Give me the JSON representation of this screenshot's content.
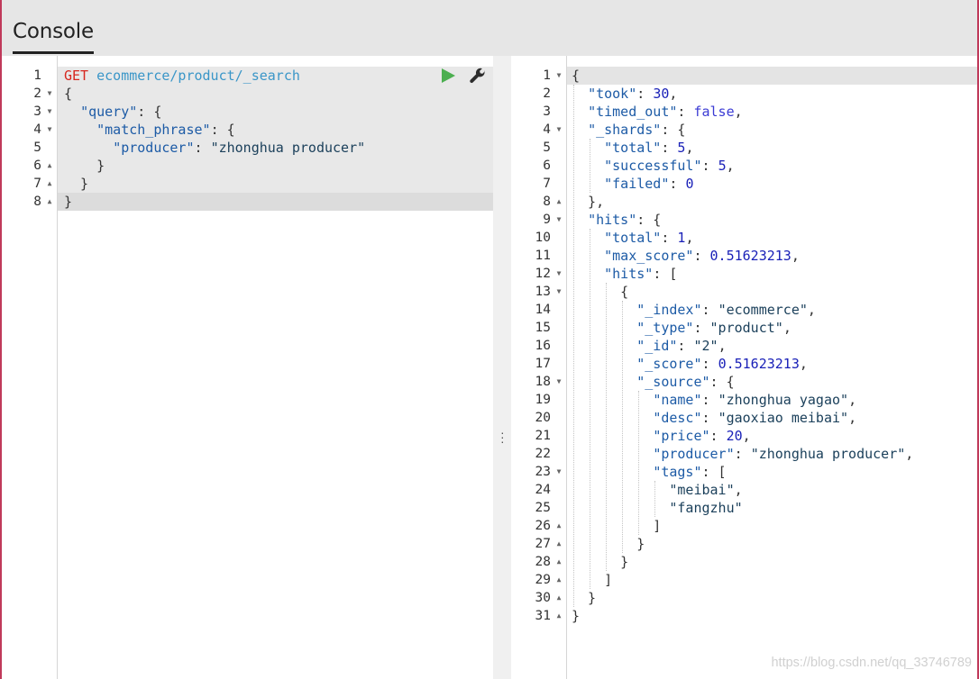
{
  "header": {
    "tab": "Console"
  },
  "request_editor": {
    "lines": [
      {
        "n": "1",
        "fold": "",
        "parts": [
          [
            "method",
            "GET"
          ],
          [
            "punc",
            " "
          ],
          [
            "url",
            "ecommerce/product/_search"
          ]
        ]
      },
      {
        "n": "2",
        "fold": "open",
        "parts": [
          [
            "punc",
            "{"
          ]
        ]
      },
      {
        "n": "3",
        "fold": "open",
        "parts": [
          [
            "punc",
            "  "
          ],
          [
            "key",
            "\"query\""
          ],
          [
            "punc",
            ": {"
          ]
        ]
      },
      {
        "n": "4",
        "fold": "open",
        "parts": [
          [
            "punc",
            "    "
          ],
          [
            "key",
            "\"match_phrase\""
          ],
          [
            "punc",
            ": {"
          ]
        ]
      },
      {
        "n": "5",
        "fold": "",
        "parts": [
          [
            "punc",
            "      "
          ],
          [
            "key",
            "\"producer\""
          ],
          [
            "punc",
            ": "
          ],
          [
            "str",
            "\"zhonghua producer\""
          ]
        ]
      },
      {
        "n": "6",
        "fold": "close",
        "parts": [
          [
            "punc",
            "    }"
          ]
        ]
      },
      {
        "n": "7",
        "fold": "close",
        "parts": [
          [
            "punc",
            "  }"
          ]
        ]
      },
      {
        "n": "8",
        "fold": "close",
        "parts": [
          [
            "punc",
            "}"
          ]
        ]
      }
    ],
    "run_icon": "play-icon",
    "settings_icon": "wrench-icon"
  },
  "response_viewer": {
    "lines": [
      {
        "n": "1",
        "fold": "open",
        "parts": [
          [
            "punc",
            "{"
          ]
        ]
      },
      {
        "n": "2",
        "fold": "",
        "parts": [
          [
            "punc",
            "  "
          ],
          [
            "key",
            "\"took\""
          ],
          [
            "punc",
            ": "
          ],
          [
            "num",
            "30"
          ],
          [
            "punc",
            ","
          ]
        ]
      },
      {
        "n": "3",
        "fold": "",
        "parts": [
          [
            "punc",
            "  "
          ],
          [
            "key",
            "\"timed_out\""
          ],
          [
            "punc",
            ": "
          ],
          [
            "bool",
            "false"
          ],
          [
            "punc",
            ","
          ]
        ]
      },
      {
        "n": "4",
        "fold": "open",
        "parts": [
          [
            "punc",
            "  "
          ],
          [
            "key",
            "\"_shards\""
          ],
          [
            "punc",
            ": {"
          ]
        ]
      },
      {
        "n": "5",
        "fold": "",
        "parts": [
          [
            "punc",
            "    "
          ],
          [
            "key",
            "\"total\""
          ],
          [
            "punc",
            ": "
          ],
          [
            "num",
            "5"
          ],
          [
            "punc",
            ","
          ]
        ]
      },
      {
        "n": "6",
        "fold": "",
        "parts": [
          [
            "punc",
            "    "
          ],
          [
            "key",
            "\"successful\""
          ],
          [
            "punc",
            ": "
          ],
          [
            "num",
            "5"
          ],
          [
            "punc",
            ","
          ]
        ]
      },
      {
        "n": "7",
        "fold": "",
        "parts": [
          [
            "punc",
            "    "
          ],
          [
            "key",
            "\"failed\""
          ],
          [
            "punc",
            ": "
          ],
          [
            "num",
            "0"
          ]
        ]
      },
      {
        "n": "8",
        "fold": "close",
        "parts": [
          [
            "punc",
            "  },"
          ]
        ]
      },
      {
        "n": "9",
        "fold": "open",
        "parts": [
          [
            "punc",
            "  "
          ],
          [
            "key",
            "\"hits\""
          ],
          [
            "punc",
            ": {"
          ]
        ]
      },
      {
        "n": "10",
        "fold": "",
        "parts": [
          [
            "punc",
            "    "
          ],
          [
            "key",
            "\"total\""
          ],
          [
            "punc",
            ": "
          ],
          [
            "num",
            "1"
          ],
          [
            "punc",
            ","
          ]
        ]
      },
      {
        "n": "11",
        "fold": "",
        "parts": [
          [
            "punc",
            "    "
          ],
          [
            "key",
            "\"max_score\""
          ],
          [
            "punc",
            ": "
          ],
          [
            "num",
            "0.51623213"
          ],
          [
            "punc",
            ","
          ]
        ]
      },
      {
        "n": "12",
        "fold": "open",
        "parts": [
          [
            "punc",
            "    "
          ],
          [
            "key",
            "\"hits\""
          ],
          [
            "punc",
            ": ["
          ]
        ]
      },
      {
        "n": "13",
        "fold": "open",
        "parts": [
          [
            "punc",
            "      {"
          ]
        ]
      },
      {
        "n": "14",
        "fold": "",
        "parts": [
          [
            "punc",
            "        "
          ],
          [
            "key",
            "\"_index\""
          ],
          [
            "punc",
            ": "
          ],
          [
            "str",
            "\"ecommerce\""
          ],
          [
            "punc",
            ","
          ]
        ]
      },
      {
        "n": "15",
        "fold": "",
        "parts": [
          [
            "punc",
            "        "
          ],
          [
            "key",
            "\"_type\""
          ],
          [
            "punc",
            ": "
          ],
          [
            "str",
            "\"product\""
          ],
          [
            "punc",
            ","
          ]
        ]
      },
      {
        "n": "16",
        "fold": "",
        "parts": [
          [
            "punc",
            "        "
          ],
          [
            "key",
            "\"_id\""
          ],
          [
            "punc",
            ": "
          ],
          [
            "str",
            "\"2\""
          ],
          [
            "punc",
            ","
          ]
        ]
      },
      {
        "n": "17",
        "fold": "",
        "parts": [
          [
            "punc",
            "        "
          ],
          [
            "key",
            "\"_score\""
          ],
          [
            "punc",
            ": "
          ],
          [
            "num",
            "0.51623213"
          ],
          [
            "punc",
            ","
          ]
        ]
      },
      {
        "n": "18",
        "fold": "open",
        "parts": [
          [
            "punc",
            "        "
          ],
          [
            "key",
            "\"_source\""
          ],
          [
            "punc",
            ": {"
          ]
        ]
      },
      {
        "n": "19",
        "fold": "",
        "parts": [
          [
            "punc",
            "          "
          ],
          [
            "key",
            "\"name\""
          ],
          [
            "punc",
            ": "
          ],
          [
            "str",
            "\"zhonghua yagao\""
          ],
          [
            "punc",
            ","
          ]
        ]
      },
      {
        "n": "20",
        "fold": "",
        "parts": [
          [
            "punc",
            "          "
          ],
          [
            "key",
            "\"desc\""
          ],
          [
            "punc",
            ": "
          ],
          [
            "str",
            "\"gaoxiao meibai\""
          ],
          [
            "punc",
            ","
          ]
        ]
      },
      {
        "n": "21",
        "fold": "",
        "parts": [
          [
            "punc",
            "          "
          ],
          [
            "key",
            "\"price\""
          ],
          [
            "punc",
            ": "
          ],
          [
            "num",
            "20"
          ],
          [
            "punc",
            ","
          ]
        ]
      },
      {
        "n": "22",
        "fold": "",
        "parts": [
          [
            "punc",
            "          "
          ],
          [
            "key",
            "\"producer\""
          ],
          [
            "punc",
            ": "
          ],
          [
            "str",
            "\"zhonghua producer\""
          ],
          [
            "punc",
            ","
          ]
        ]
      },
      {
        "n": "23",
        "fold": "open",
        "parts": [
          [
            "punc",
            "          "
          ],
          [
            "key",
            "\"tags\""
          ],
          [
            "punc",
            ": ["
          ]
        ]
      },
      {
        "n": "24",
        "fold": "",
        "parts": [
          [
            "punc",
            "            "
          ],
          [
            "str",
            "\"meibai\""
          ],
          [
            "punc",
            ","
          ]
        ]
      },
      {
        "n": "25",
        "fold": "",
        "parts": [
          [
            "punc",
            "            "
          ],
          [
            "str",
            "\"fangzhu\""
          ]
        ]
      },
      {
        "n": "26",
        "fold": "close",
        "parts": [
          [
            "punc",
            "          ]"
          ]
        ]
      },
      {
        "n": "27",
        "fold": "close",
        "parts": [
          [
            "punc",
            "        }"
          ]
        ]
      },
      {
        "n": "28",
        "fold": "close",
        "parts": [
          [
            "punc",
            "      }"
          ]
        ]
      },
      {
        "n": "29",
        "fold": "close",
        "parts": [
          [
            "punc",
            "    ]"
          ]
        ]
      },
      {
        "n": "30",
        "fold": "close",
        "parts": [
          [
            "punc",
            "  }"
          ]
        ]
      },
      {
        "n": "31",
        "fold": "close",
        "parts": [
          [
            "punc",
            "}"
          ]
        ]
      }
    ]
  },
  "watermark": "https://blog.csdn.net/qq_33746789",
  "colors": {
    "method": "#d7261e",
    "url": "#3a96c8",
    "key": "#1d5ba6",
    "string": "#1a3f5a",
    "number": "#1a21b8",
    "boolean": "#3b3bd4",
    "run_button": "#4caf50",
    "accent_border": "#c0395a"
  }
}
